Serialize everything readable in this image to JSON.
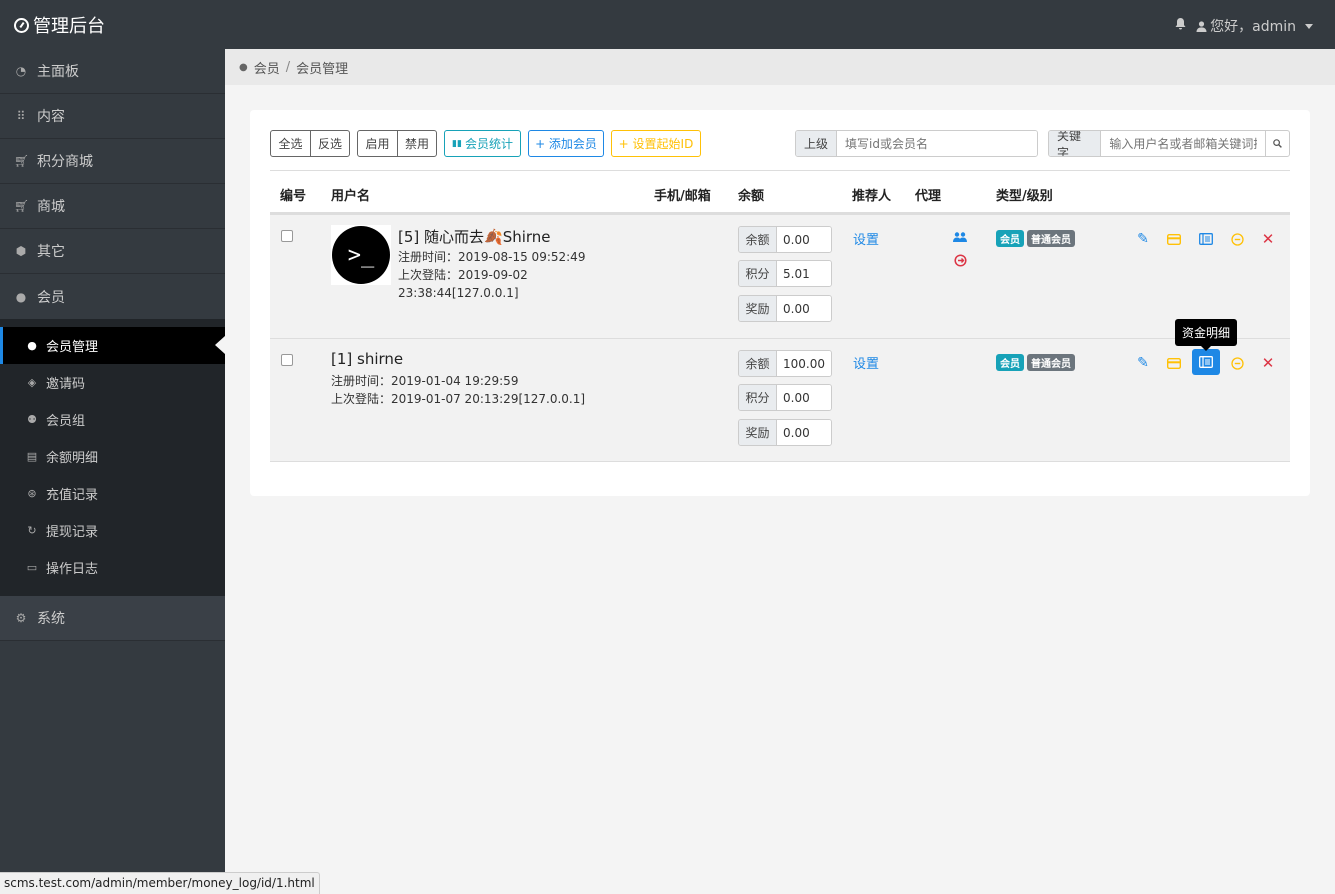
{
  "app": {
    "title": "管理后台"
  },
  "topbar": {
    "greeting": "您好，admin"
  },
  "sidebar": {
    "items": [
      {
        "label": "主面板",
        "icon": "dashboard-icon"
      },
      {
        "label": "内容",
        "icon": "grid-icon"
      },
      {
        "label": "积分商城",
        "icon": "cart-icon"
      },
      {
        "label": "商城",
        "icon": "cart-icon"
      },
      {
        "label": "其它",
        "icon": "box-icon"
      },
      {
        "label": "会员",
        "icon": "person-icon"
      }
    ],
    "subitems": [
      {
        "label": "会员管理",
        "icon": "person-icon"
      },
      {
        "label": "邀请码",
        "icon": "tag-icon"
      },
      {
        "label": "会员组",
        "icon": "people-icon"
      },
      {
        "label": "余额明细",
        "icon": "ledger-icon"
      },
      {
        "label": "充值记录",
        "icon": "recharge-icon"
      },
      {
        "label": "提现记录",
        "icon": "withdraw-icon"
      },
      {
        "label": "操作日志",
        "icon": "clipboard-icon"
      }
    ],
    "system": {
      "label": "系统",
      "icon": "gear-icon"
    }
  },
  "breadcrumb": {
    "parent": "会员",
    "sep": "/",
    "current": "会员管理"
  },
  "toolbar": {
    "select_all": "全选",
    "invert": "反选",
    "enable": "启用",
    "disable": "禁用",
    "stats": "会员统计",
    "add": "+ 添加会员",
    "set_start_id": "+ 设置起始ID",
    "parent_label": "上级",
    "parent_placeholder": "填写id或会员名",
    "keyword_label": "关键字",
    "keyword_placeholder": "输入用户名或者邮箱关键词搜索"
  },
  "table": {
    "headers": [
      "编号",
      "用户名",
      "手机/邮箱",
      "余额",
      "推荐人",
      "代理",
      "类型/级别"
    ],
    "rows": [
      {
        "name": "[5] 随心而去🍂Shirne",
        "avatar_text": ">_",
        "reg_time": "注册时间：2019-08-15 09:52:49",
        "last_login_1": "上次登陆：2019-09-02",
        "last_login_2": "23:38:44[127.0.0.1]",
        "balance_label": "余额",
        "balance": "0.00",
        "points_label": "积分",
        "points": "5.01",
        "reward_label": "奖励",
        "reward": "0.00",
        "referrer": "设置",
        "type_badge": "会员",
        "level_badge": "普通会员"
      },
      {
        "name": "[1] shirne",
        "reg_time": "注册时间：2019-01-04 19:29:59",
        "last_login": "上次登陆：2019-01-07 20:13:29[127.0.0.1]",
        "balance_label": "余额",
        "balance": "100.00",
        "points_label": "积分",
        "points": "0.00",
        "reward_label": "奖励",
        "reward": "0.00",
        "referrer": "设置",
        "type_badge": "会员",
        "level_badge": "普通会员"
      }
    ]
  },
  "tooltip": {
    "text": "资金明细"
  },
  "statusbar": {
    "url": "scms.test.com/admin/member/money_log/id/1.html"
  },
  "colors": {
    "primary": "#1e88e5",
    "info": "#17a2b8",
    "warning": "#ffc107",
    "danger": "#dc3545",
    "sidebar": "#343a40"
  }
}
